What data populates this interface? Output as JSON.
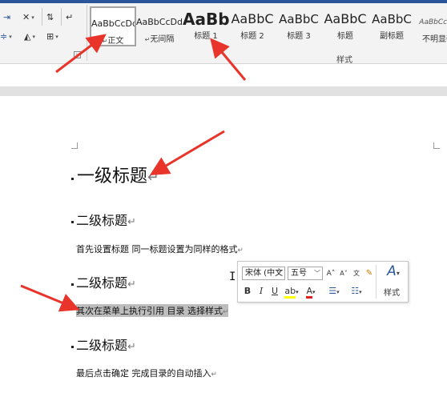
{
  "ribbon": {
    "styles": [
      {
        "sample": "AaBbCcDd",
        "name": "正文",
        "selected": true,
        "sample_size": 11,
        "bold": false,
        "mark": "↵"
      },
      {
        "sample": "AaBbCcDd",
        "name": "无间隔",
        "selected": false,
        "sample_size": 11,
        "bold": false,
        "mark": "↵"
      },
      {
        "sample": "AaBb",
        "name": "标题 1",
        "selected": false,
        "sample_size": 20,
        "bold": true,
        "mark": ""
      },
      {
        "sample": "AaBbC",
        "name": "标题 2",
        "selected": false,
        "sample_size": 16,
        "bold": false,
        "mark": ""
      },
      {
        "sample": "AaBbC",
        "name": "标题 3",
        "selected": false,
        "sample_size": 15,
        "bold": false,
        "mark": ""
      },
      {
        "sample": "AaBbC",
        "name": "标题",
        "selected": false,
        "sample_size": 16,
        "bold": false,
        "mark": ""
      },
      {
        "sample": "AaBbC",
        "name": "副标题",
        "selected": false,
        "sample_size": 15,
        "bold": false,
        "mark": ""
      },
      {
        "sample": "AaBbCcDd",
        "name": "不明显强",
        "selected": false,
        "sample_size": 9,
        "bold": false,
        "mark": ""
      }
    ],
    "group_label": "样式"
  },
  "document": {
    "lines": [
      {
        "kind": "h1",
        "text": "一级标题",
        "mark": "↵"
      },
      {
        "kind": "h2",
        "text": "二级标题",
        "mark": "↵"
      },
      {
        "kind": "body",
        "text": "首先设置标题  同一标题设置为同样的格式",
        "mark": "↵"
      },
      {
        "kind": "h2",
        "text": "二级标题",
        "mark": "↵"
      },
      {
        "kind": "body",
        "text": "其次在菜单上执行引用  目录  选择样式",
        "mark": "↵",
        "selected": true
      },
      {
        "kind": "h2",
        "text": "二级标题",
        "mark": "↵"
      },
      {
        "kind": "body",
        "text": "最后点击确定  完成目录的自动插入",
        "mark": "↵"
      }
    ]
  },
  "mini_toolbar": {
    "font": "宋体 (中文",
    "size": "五号",
    "styles_label": "样式"
  },
  "colors": {
    "accent": "#2b579a",
    "highlight": "#ffff00",
    "font_color": "#e02020",
    "arrow": "#e8342a",
    "selection": "#bdbdbd"
  },
  "icons": [
    "indent-icon",
    "sort-icon",
    "pilcrow-icon",
    "shading-icon",
    "borders-icon",
    "grow-font-icon",
    "shrink-font-icon",
    "phonetic-icon",
    "format-painter-icon",
    "bold-icon",
    "italic-icon",
    "underline-icon",
    "highlight-icon",
    "font-color-icon",
    "bullets-icon",
    "numbering-icon",
    "styles-icon",
    "text-cursor-icon"
  ]
}
